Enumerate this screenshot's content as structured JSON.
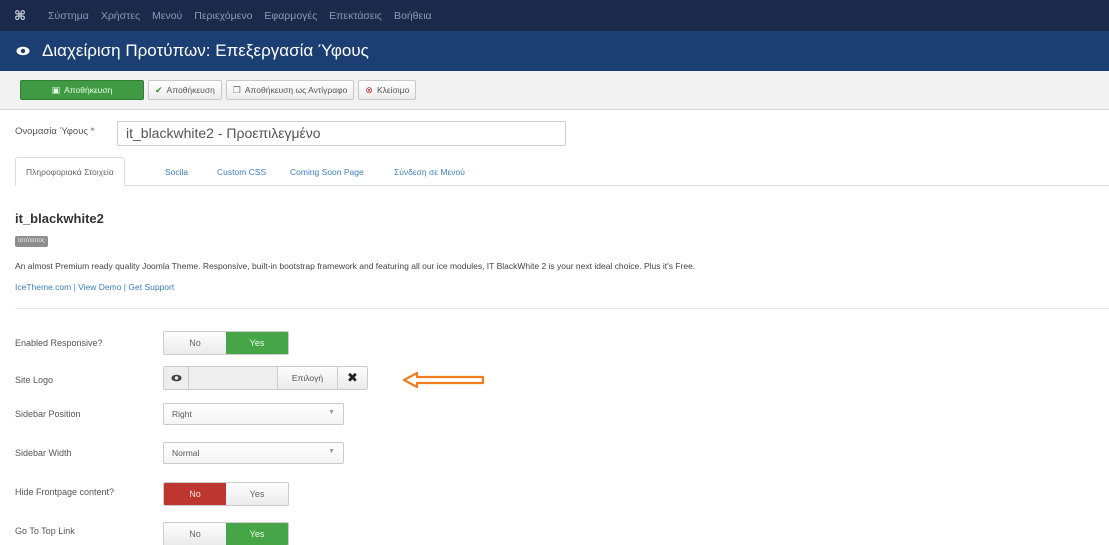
{
  "topbar": {
    "logo": "⌘",
    "menu": [
      "Σύστημα",
      "Χρήστες",
      "Μενού",
      "Περιεχόμενο",
      "Εφαρμογές",
      "Επεκτάσεις",
      "Βοήθεια"
    ]
  },
  "titlebar": {
    "icon": "eye-icon",
    "title": "Διαχείριση Προτύπων: Επεξεργασία Ύφους"
  },
  "toolbar": {
    "save_label": "Αποθήκευση",
    "save_close_label": "Αποθήκευση",
    "save_copy_label": "Αποθήκευση ως Αντίγραφο",
    "close_label": "Κλείσιμο",
    "primary_color": "#3f9a43"
  },
  "style_name": {
    "label": "Ονομασία Ύφους *",
    "value": "it_blackwhite2 - Προεπιλεγμένο"
  },
  "tabs": [
    {
      "label": "Πληροφοριακά Στοιχεία",
      "active": true
    },
    {
      "label": "Socila",
      "active": false
    },
    {
      "label": "Custom CSS",
      "active": false
    },
    {
      "label": "Coming Soon Page",
      "active": false
    },
    {
      "label": "Σύνδεση σε Μενού",
      "active": false
    }
  ],
  "template": {
    "name": "it_blackwhite2",
    "badge": "Ιστότοπος",
    "description": "An almost Premium ready quality Joomla Theme. Responsive, built-in bootstrap framework and featuring all our ice modules, IT BlackWhite 2 is your next ideal choice. Plus it's Free.",
    "links": "IceTheme.com | View Demo | Get Support"
  },
  "settings": {
    "responsive": {
      "label": "Enabled Responsive?",
      "no": "No",
      "yes": "Yes",
      "selected": "yes"
    },
    "site_logo": {
      "label": "Site Logo",
      "select": "Επιλογή",
      "clear": "✖"
    },
    "sidebar_position": {
      "label": "Sidebar Position",
      "value": "Right"
    },
    "sidebar_width": {
      "label": "Sidebar Width",
      "value": "Normal"
    },
    "hide_frontpage": {
      "label": "Hide Frontpage content?",
      "no": "No",
      "yes": "Yes",
      "selected": "no"
    },
    "go_to_top": {
      "label": "Go To Top Link",
      "no": "No",
      "yes": "Yes",
      "selected": "yes"
    }
  },
  "annotation": {
    "arrow_color": "#f07d1f"
  }
}
